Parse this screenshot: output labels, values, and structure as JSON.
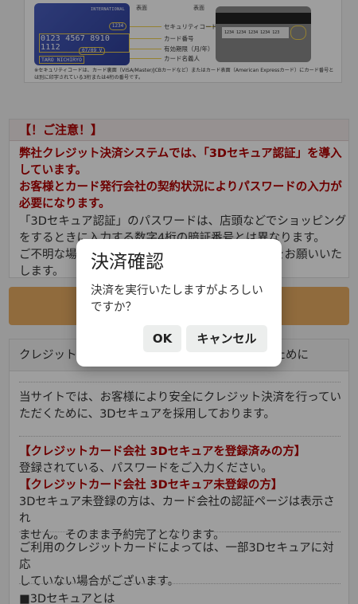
{
  "card_guide": {
    "front_label": "表面",
    "back_label": "表面",
    "card_brand_text": "INTERNATIONAL",
    "card_cvv_sample": "1234",
    "card_number": "0123 4567 8910 1112",
    "card_expiry": "07/09 V",
    "card_name": "TARO NICHIRYO",
    "back_number": "1234 1234 1234 1234 123",
    "callouts": [
      "セキュリティコード",
      "カード番号",
      "有効期限（月/年）",
      "カード名義人"
    ],
    "note": "※セキュリティコードは、カード裏面（VISA/Master/JCBカードなど）またはカード表面（American Expressカード）にカード番号とは別に印字されている3桁または4桁の番号です。"
  },
  "attention": {
    "heading": "【！ご注意！】",
    "red_lines": [
      "弊社クレジット決済システムでは、「3Dセキュア認証」を導入",
      "しています。",
      "お客様とカード発行会社の契約状況によりパスワードの入力が",
      "必要になります。"
    ],
    "body_lines": [
      "「3Dセキュア認証」のパスワードは、店頭などでショッピング",
      "をするときに入力する数字4桁の暗証番号とは異なります。",
      "ご不明な場合は、カード発行会社へお問い合わせをお願いいた",
      "します。"
    ]
  },
  "info": {
    "heading_start": "クレジット",
    "heading_end": "ために",
    "p1_lines": [
      "当サイトでは、お客様により安全にクレジット決済を行ってい",
      "ただくために、3Dセキュアを採用しております。"
    ],
    "registered_heading": "【クレジットカード会社 3Dセキュアを登録済みの方】",
    "registered_text": "登録されている、パスワードをご入力ください。",
    "unregistered_heading": "【クレジットカード会社 3Dセキュア未登録の方】",
    "unregistered_lines": [
      "3Dセキュア未登録の方は、カード会社の認証ページは表示され",
      "ません。そのまま予約完了となります。"
    ],
    "p3_lines": [
      "ご利用のクレジットカードによっては、一部3Dセキュアに対応",
      "していない場合がございます。"
    ],
    "p4": "■3Dセキュアとは"
  },
  "dialog": {
    "title": "決済確認",
    "message_lines": [
      "決済を実行いたしますがよろしい",
      "ですか？"
    ],
    "ok_label": "OK",
    "cancel_label": "キャンセル"
  },
  "colors": {
    "accent_red": "#b00000",
    "action_orange": "#e8ad63",
    "overlay": "rgba(0,0,0,0.38)"
  }
}
